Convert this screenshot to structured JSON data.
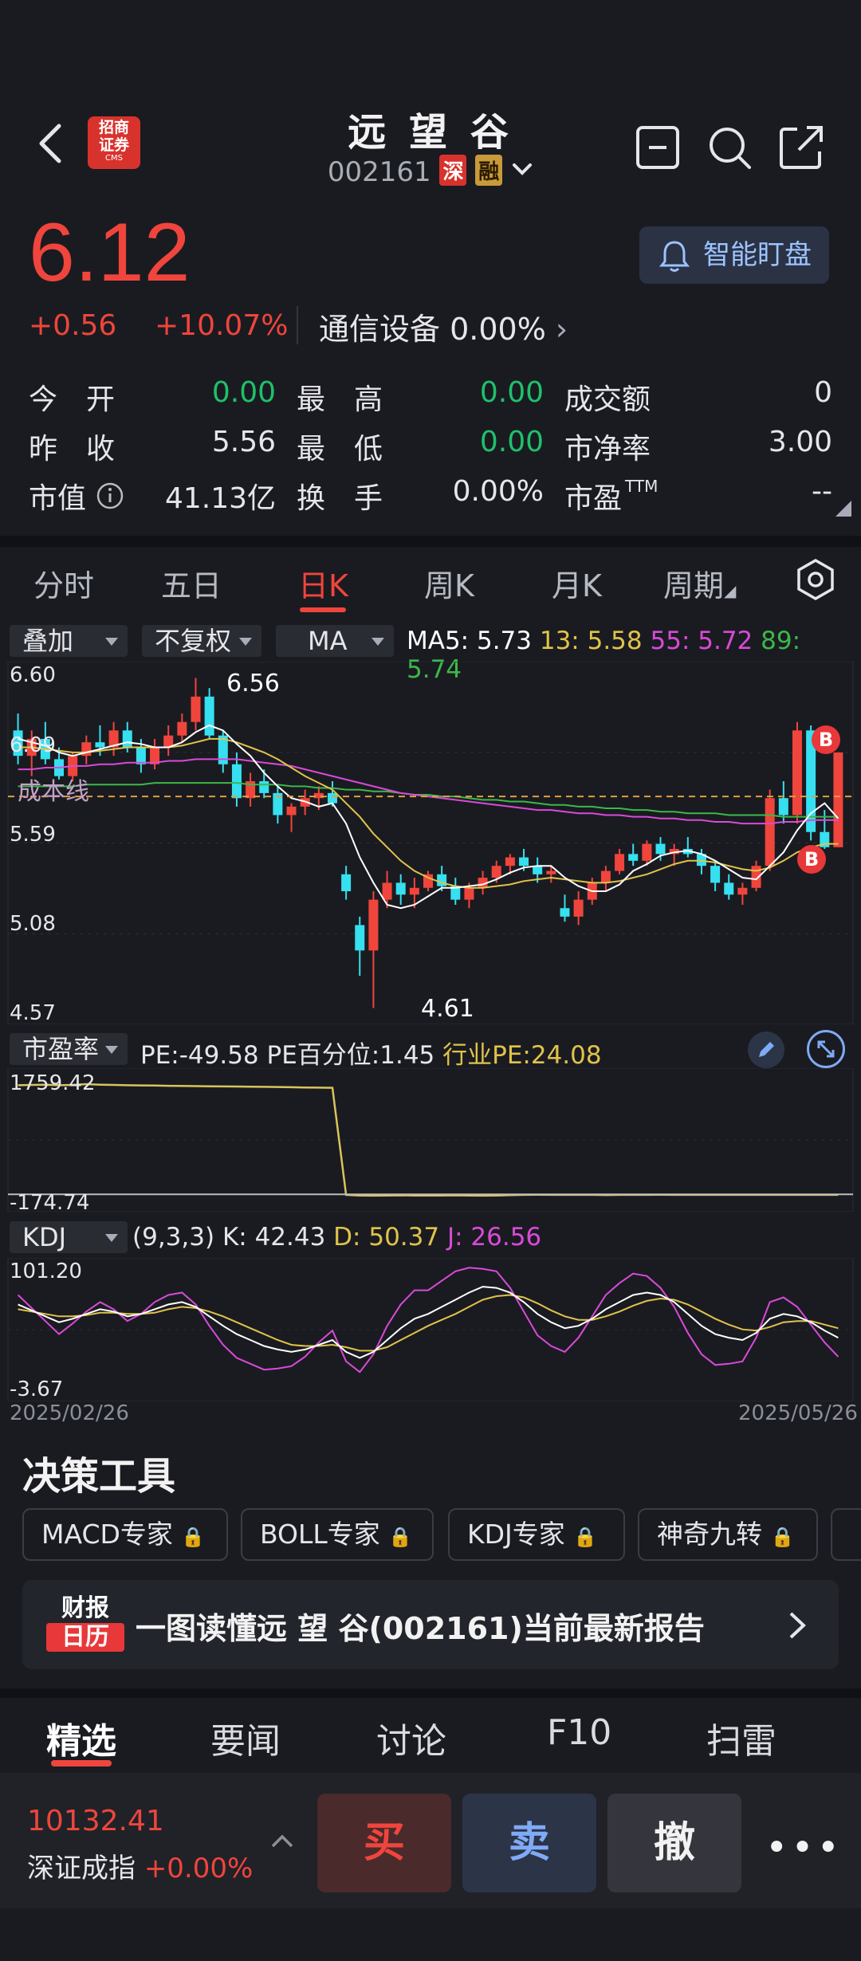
{
  "header": {
    "title": "远 望 谷",
    "code": "002161",
    "badge_shen": "深",
    "badge_rong": "融",
    "broker_logo_line1": "招商",
    "broker_logo_line2": "证券",
    "broker_logo_sub": "CMS"
  },
  "quote": {
    "price": "6.12",
    "change": "+0.56",
    "change_pct": "+10.07%",
    "sector": "通信设备 0.00%",
    "monitor_label": "智能盯盘"
  },
  "stats": {
    "open_label": "今　开",
    "open_value": "0.00",
    "high_label": "最　高",
    "high_value": "0.00",
    "turnover_amt_label": "成交额",
    "turnover_amt_value": "0",
    "prev_label": "昨　收",
    "prev_value": "5.56",
    "low_label": "最　低",
    "low_value": "0.00",
    "pb_label": "市净率",
    "pb_value": "3.00",
    "mcap_label": "市值",
    "mcap_value": "41.13亿",
    "turnover_label": "换　手",
    "turnover_value": "0.00%",
    "pe_label": "市盈",
    "pe_sup": "TTM",
    "pe_value": "--"
  },
  "chart_tabs": [
    {
      "label": "分时"
    },
    {
      "label": "五日"
    },
    {
      "label": "日K"
    },
    {
      "label": "周K"
    },
    {
      "label": "月K"
    },
    {
      "label": "周期"
    }
  ],
  "chart_controls": {
    "overlay": "叠加",
    "adjust": "不复权",
    "ma": "MA",
    "ma5": "MA5: 5.73",
    "ma13": "13: 5.58",
    "ma55": "55: 5.72",
    "ma89": "89: 5.74",
    "cost_line": "成本线",
    "high_mark": "6.56",
    "low_mark": "4.61",
    "buy_marker": "B"
  },
  "pe_panel": {
    "selector": "市盈率",
    "pe": "PE:-49.58",
    "pe_pct": "PE百分位:1.45",
    "industry_pe": "行业PE:24.08",
    "y_top": "1759.42",
    "y_bottom": "-174.74"
  },
  "kdj_panel": {
    "selector": "KDJ",
    "params": "(9,3,3)",
    "k": "K: 42.43",
    "d": "D: 50.37",
    "j": "J: 26.56",
    "y_top": "101.20",
    "y_bottom": "-3.67",
    "date_start": "2025/02/26",
    "date_end": "2025/05/26"
  },
  "chart_data": {
    "type": "candlestick",
    "y_ticks": [
      "6.60",
      "6.09",
      "5.59",
      "5.08",
      "4.57"
    ],
    "ylim": [
      4.57,
      6.6
    ],
    "x_range": [
      "2025/02/26",
      "2025/05/26"
    ],
    "ohlc": [
      [
        6.25,
        6.35,
        6.05,
        6.1
      ],
      [
        6.1,
        6.25,
        5.98,
        6.2
      ],
      [
        6.2,
        6.3,
        6.05,
        6.08
      ],
      [
        6.08,
        6.15,
        5.96,
        5.98
      ],
      [
        5.98,
        6.12,
        5.95,
        6.1
      ],
      [
        6.1,
        6.22,
        6.05,
        6.18
      ],
      [
        6.18,
        6.28,
        6.1,
        6.15
      ],
      [
        6.15,
        6.3,
        6.1,
        6.25
      ],
      [
        6.25,
        6.3,
        6.12,
        6.15
      ],
      [
        6.15,
        6.2,
        6.0,
        6.05
      ],
      [
        6.05,
        6.2,
        6.02,
        6.15
      ],
      [
        6.15,
        6.28,
        6.1,
        6.22
      ],
      [
        6.22,
        6.35,
        6.18,
        6.3
      ],
      [
        6.3,
        6.56,
        6.25,
        6.45
      ],
      [
        6.45,
        6.5,
        6.2,
        6.22
      ],
      [
        6.22,
        6.25,
        6.0,
        6.05
      ],
      [
        6.05,
        6.12,
        5.8,
        5.85
      ],
      [
        5.85,
        6.0,
        5.8,
        5.95
      ],
      [
        5.95,
        6.02,
        5.85,
        5.88
      ],
      [
        5.88,
        5.92,
        5.7,
        5.75
      ],
      [
        5.75,
        5.82,
        5.65,
        5.8
      ],
      [
        5.8,
        5.9,
        5.75,
        5.85
      ],
      [
        5.85,
        5.92,
        5.78,
        5.88
      ],
      [
        5.88,
        5.95,
        5.8,
        5.82
      ],
      [
        5.4,
        5.45,
        5.25,
        5.3
      ],
      [
        5.1,
        5.15,
        4.8,
        4.95
      ],
      [
        4.95,
        5.3,
        4.61,
        5.25
      ],
      [
        5.25,
        5.42,
        5.2,
        5.35
      ],
      [
        5.35,
        5.4,
        5.22,
        5.28
      ],
      [
        5.28,
        5.38,
        5.2,
        5.32
      ],
      [
        5.32,
        5.42,
        5.3,
        5.4
      ],
      [
        5.4,
        5.45,
        5.3,
        5.33
      ],
      [
        5.33,
        5.38,
        5.22,
        5.25
      ],
      [
        5.25,
        5.35,
        5.2,
        5.32
      ],
      [
        5.32,
        5.42,
        5.28,
        5.38
      ],
      [
        5.38,
        5.48,
        5.35,
        5.45
      ],
      [
        5.45,
        5.52,
        5.4,
        5.5
      ],
      [
        5.5,
        5.55,
        5.42,
        5.45
      ],
      [
        5.45,
        5.5,
        5.35,
        5.4
      ],
      [
        5.4,
        5.45,
        5.35,
        5.42
      ],
      [
        5.2,
        5.28,
        5.12,
        5.15
      ],
      [
        5.15,
        5.3,
        5.1,
        5.25
      ],
      [
        5.25,
        5.38,
        5.22,
        5.35
      ],
      [
        5.35,
        5.45,
        5.3,
        5.42
      ],
      [
        5.42,
        5.55,
        5.4,
        5.52
      ],
      [
        5.52,
        5.58,
        5.45,
        5.48
      ],
      [
        5.48,
        5.6,
        5.45,
        5.58
      ],
      [
        5.58,
        5.62,
        5.48,
        5.52
      ],
      [
        5.52,
        5.58,
        5.45,
        5.55
      ],
      [
        5.55,
        5.62,
        5.5,
        5.52
      ],
      [
        5.52,
        5.55,
        5.4,
        5.45
      ],
      [
        5.45,
        5.48,
        5.3,
        5.35
      ],
      [
        5.35,
        5.4,
        5.25,
        5.28
      ],
      [
        5.28,
        5.35,
        5.22,
        5.32
      ],
      [
        5.32,
        5.48,
        5.3,
        5.45
      ],
      [
        5.45,
        5.9,
        5.42,
        5.85
      ],
      [
        5.85,
        5.95,
        5.7,
        5.75
      ],
      [
        5.75,
        6.3,
        5.7,
        6.25
      ],
      [
        6.25,
        6.28,
        5.6,
        5.65
      ],
      [
        5.65,
        5.78,
        5.55,
        5.56
      ],
      [
        5.56,
        6.12,
        5.56,
        6.12
      ]
    ],
    "pe_series": [
      1740,
      1745,
      1750,
      1740,
      1745,
      1759,
      1750,
      1745,
      1740,
      1738,
      1735,
      1730,
      1728,
      1725,
      1722,
      1720,
      1718,
      1715,
      1712,
      1710,
      1705,
      1700,
      1698,
      1696,
      -160,
      -170,
      -174,
      -170,
      -168,
      -170,
      -172,
      -170,
      -168,
      -172,
      -174,
      -170,
      -165,
      -160,
      -158,
      -160,
      -160,
      -160,
      -160,
      -162,
      -160,
      -160,
      -160,
      -158,
      -160,
      -160,
      -160,
      -160,
      -160,
      -160,
      -160,
      -160,
      -160,
      -160,
      -160,
      -160,
      -160
    ],
    "kdj_k": [
      70,
      65,
      60,
      55,
      58,
      62,
      66,
      64,
      60,
      62,
      66,
      70,
      72,
      68,
      60,
      52,
      45,
      40,
      35,
      32,
      30,
      32,
      36,
      40,
      30,
      25,
      30,
      40,
      50,
      58,
      62,
      68,
      74,
      80,
      85,
      84,
      80,
      72,
      62,
      55,
      50,
      52,
      58,
      66,
      72,
      78,
      80,
      78,
      72,
      62,
      52,
      45,
      42,
      40,
      46,
      58,
      62,
      60,
      55,
      48,
      42
    ],
    "kdj_d": [
      66,
      64,
      62,
      60,
      60,
      61,
      63,
      63,
      62,
      62,
      63,
      66,
      68,
      67,
      64,
      60,
      55,
      50,
      45,
      40,
      36,
      35,
      35,
      36,
      34,
      31,
      31,
      34,
      40,
      46,
      52,
      57,
      62,
      68,
      74,
      77,
      78,
      76,
      71,
      65,
      60,
      57,
      57,
      60,
      64,
      69,
      73,
      75,
      74,
      70,
      64,
      58,
      53,
      49,
      48,
      51,
      55,
      56,
      56,
      53,
      50
    ],
    "kdj_j": [
      78,
      67,
      56,
      45,
      54,
      64,
      72,
      66,
      56,
      62,
      72,
      78,
      80,
      70,
      52,
      36,
      25,
      20,
      15,
      16,
      18,
      26,
      38,
      48,
      22,
      13,
      28,
      52,
      70,
      82,
      82,
      90,
      98,
      101,
      100,
      98,
      84,
      64,
      44,
      35,
      30,
      42,
      60,
      78,
      88,
      96,
      94,
      84,
      68,
      46,
      28,
      19,
      20,
      22,
      42,
      72,
      76,
      68,
      53,
      38,
      26
    ],
    "ma5": [
      6.2,
      6.18,
      6.16,
      6.12,
      6.1,
      6.12,
      6.14,
      6.16,
      6.18,
      6.17,
      6.15,
      6.15,
      6.18,
      6.24,
      6.28,
      6.25,
      6.17,
      6.1,
      6.0,
      5.92,
      5.85,
      5.83,
      5.8,
      5.82,
      5.7,
      5.5,
      5.35,
      5.22,
      5.2,
      5.22,
      5.27,
      5.32,
      5.32,
      5.33,
      5.34,
      5.37,
      5.41,
      5.44,
      5.45,
      5.45,
      5.38,
      5.33,
      5.3,
      5.3,
      5.34,
      5.42,
      5.46,
      5.51,
      5.53,
      5.54,
      5.52,
      5.48,
      5.43,
      5.38,
      5.37,
      5.45,
      5.53,
      5.66,
      5.76,
      5.82,
      5.73
    ],
    "ma13": [
      6.15,
      6.15,
      6.14,
      6.13,
      6.12,
      6.12,
      6.13,
      6.14,
      6.15,
      6.15,
      6.15,
      6.15,
      6.16,
      6.18,
      6.2,
      6.2,
      6.18,
      6.15,
      6.12,
      6.08,
      6.03,
      5.98,
      5.94,
      5.9,
      5.82,
      5.74,
      5.64,
      5.56,
      5.48,
      5.42,
      5.38,
      5.35,
      5.33,
      5.32,
      5.32,
      5.33,
      5.34,
      5.36,
      5.37,
      5.38,
      5.37,
      5.36,
      5.35,
      5.35,
      5.36,
      5.38,
      5.4,
      5.43,
      5.46,
      5.48,
      5.48,
      5.47,
      5.45,
      5.43,
      5.42,
      5.44,
      5.48,
      5.53,
      5.56,
      5.58,
      5.58
    ],
    "ma55": [
      6.02,
      6.02,
      6.03,
      6.03,
      6.04,
      6.04,
      6.05,
      6.05,
      6.06,
      6.06,
      6.06,
      6.07,
      6.07,
      6.08,
      6.08,
      6.08,
      6.08,
      6.07,
      6.06,
      6.05,
      6.04,
      6.02,
      6.0,
      5.98,
      5.96,
      5.94,
      5.92,
      5.9,
      5.88,
      5.87,
      5.86,
      5.85,
      5.84,
      5.83,
      5.82,
      5.81,
      5.8,
      5.79,
      5.78,
      5.78,
      5.77,
      5.76,
      5.76,
      5.75,
      5.75,
      5.74,
      5.74,
      5.73,
      5.73,
      5.72,
      5.72,
      5.71,
      5.71,
      5.7,
      5.7,
      5.7,
      5.71,
      5.71,
      5.72,
      5.72,
      5.72
    ],
    "ma89": [
      5.92,
      5.92,
      5.92,
      5.92,
      5.92,
      5.93,
      5.93,
      5.93,
      5.93,
      5.93,
      5.94,
      5.94,
      5.94,
      5.94,
      5.94,
      5.94,
      5.94,
      5.93,
      5.93,
      5.93,
      5.92,
      5.92,
      5.91,
      5.91,
      5.9,
      5.9,
      5.89,
      5.89,
      5.88,
      5.87,
      5.87,
      5.86,
      5.86,
      5.85,
      5.84,
      5.84,
      5.83,
      5.83,
      5.82,
      5.81,
      5.81,
      5.8,
      5.8,
      5.79,
      5.79,
      5.78,
      5.78,
      5.77,
      5.77,
      5.76,
      5.76,
      5.76,
      5.75,
      5.75,
      5.75,
      5.75,
      5.74,
      5.74,
      5.74,
      5.74,
      5.74
    ],
    "cost_line": 5.86,
    "colors": {
      "up": "#f0453c",
      "down": "#36e0f0",
      "ma5": "#ffffff",
      "ma13": "#e0c34a",
      "ma55": "#d94ad8",
      "ma89": "#3cb84a",
      "pe": "#d9c45a",
      "pe2": "#bdbdbd"
    }
  },
  "tools": {
    "title": "决策工具",
    "items": [
      "MACD专家",
      "BOLL专家",
      "KDJ专家",
      "神奇九转"
    ],
    "report_logo_top": "财报",
    "report_logo_bottom": "日历",
    "report_text": "一图读懂远 望 谷(002161)当前最新报告"
  },
  "news_tabs": [
    {
      "label": "精选"
    },
    {
      "label": "要闻"
    },
    {
      "label": "讨论"
    },
    {
      "label": "F10"
    },
    {
      "label": "扫雷"
    }
  ],
  "bottom": {
    "index_value": "10132.41",
    "index_name": "深证成指",
    "index_change": "+0.00%",
    "buy": "买",
    "sell": "卖",
    "cancel": "撤",
    "more": "•••"
  }
}
